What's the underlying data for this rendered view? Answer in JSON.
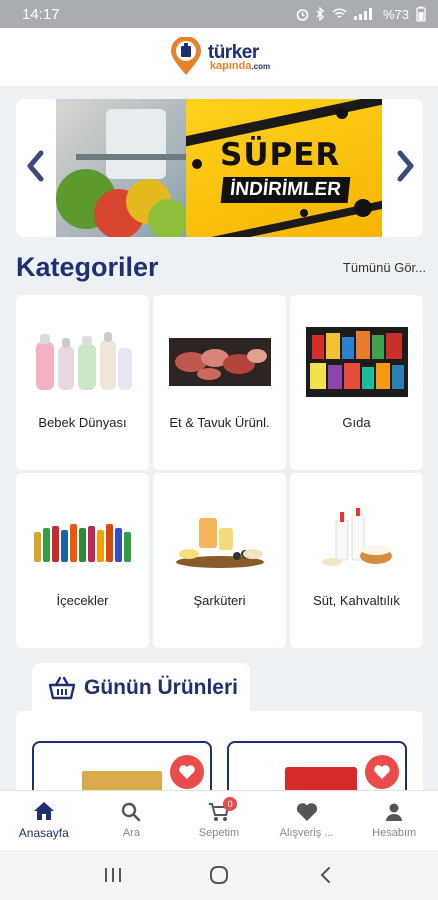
{
  "status_bar": {
    "time": "14:17",
    "battery": "%73"
  },
  "header": {
    "logo_main": "türker",
    "logo_sub": "kapında",
    "logo_tld": ".com"
  },
  "banner": {
    "headline": "SÜPER",
    "subline": "İNDİRİMLER"
  },
  "categories": {
    "title": "Kategoriler",
    "see_all": "Tümünü Gör...",
    "items": [
      {
        "label": "Bebek Dünyası",
        "icon": "baby-bottles-image"
      },
      {
        "label": "Et & Tavuk Ürünl.",
        "icon": "meat-image"
      },
      {
        "label": "Gıda",
        "icon": "groceries-image"
      },
      {
        "label": "İçecekler",
        "icon": "beverages-image"
      },
      {
        "label": "Şarküteri",
        "icon": "deli-image"
      },
      {
        "label": "Süt, Kahvaltılık",
        "icon": "dairy-image"
      }
    ]
  },
  "daily": {
    "title": "Günün Ürünleri",
    "icon": "basket-icon"
  },
  "bottom_nav": {
    "items": [
      {
        "label": "Anasayfa",
        "icon": "home-icon",
        "active": true
      },
      {
        "label": "Ara",
        "icon": "search-icon",
        "active": false
      },
      {
        "label": "Sepetim",
        "icon": "cart-icon",
        "active": false,
        "badge": "0"
      },
      {
        "label": "Alışveriş ...",
        "icon": "heart-icon",
        "active": false
      },
      {
        "label": "Hesabım",
        "icon": "user-icon",
        "active": false
      }
    ]
  },
  "colors": {
    "brand": "#1e2f74",
    "accent": "#e8822a",
    "favorite": "#ea4b4b",
    "banner": "#ffd21e"
  }
}
